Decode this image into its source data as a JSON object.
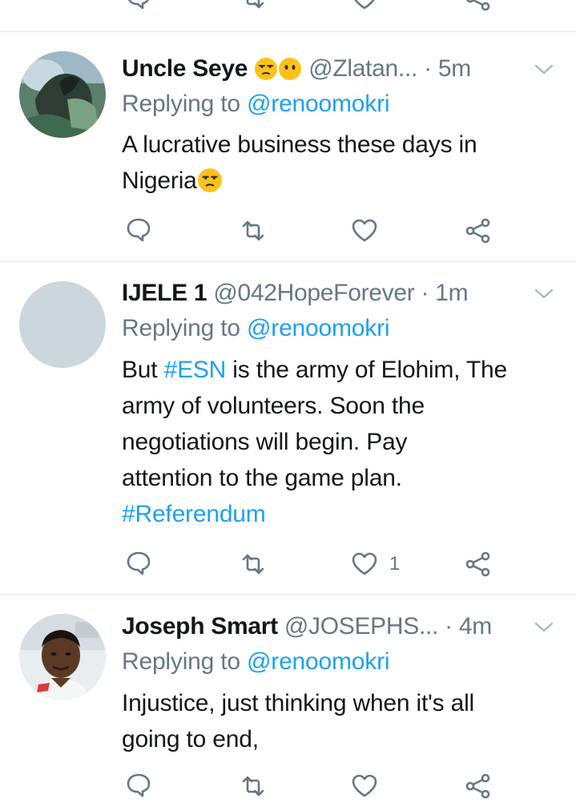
{
  "colors": {
    "accent": "#1da1f2",
    "secondary_text": "#657786",
    "divider": "#e1e8ed"
  },
  "tweets": [
    {
      "name": "Uncle Seye",
      "name_emoji": [
        "unamused-face",
        "face-without-mouth"
      ],
      "handle": "@Zlatan...",
      "time": "5m",
      "replying_label": "Replying to",
      "replying_to": "@renoomokri",
      "text_lines": [
        "A lucrative business these days in",
        "Nigeria"
      ],
      "text_emoji": "unamused-face",
      "likes": ""
    },
    {
      "name": "IJELE 1",
      "handle": "@042HopeForever",
      "time": "1m",
      "replying_label": "Replying to",
      "replying_to": "@renoomokri",
      "text_segments": {
        "pre": "But ",
        "hashtag1": "#ESN",
        "line1_rest": " is the army of Elohim, The",
        "line2": "army of volunteers. Soon the",
        "line3": "negotiations will begin. Pay",
        "line4": "attention to the game plan.",
        "hashtag2": "#Referendum"
      },
      "likes": "1"
    },
    {
      "name": "Joseph Smart",
      "handle": "@JOSEPHS...",
      "time": "4m",
      "replying_label": "Replying to",
      "replying_to": "@renoomokri",
      "text_lines": [
        "Injustice, just thinking when it's all",
        "going to end,"
      ],
      "likes": ""
    }
  ],
  "separator_dot": "·"
}
